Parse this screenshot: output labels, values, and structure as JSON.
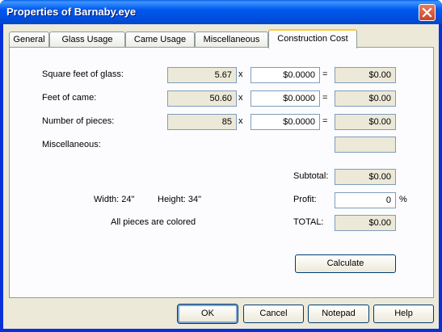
{
  "window": {
    "title": "Properties of Barnaby.eye"
  },
  "tabs": [
    {
      "label": "General"
    },
    {
      "label": "Glass Usage"
    },
    {
      "label": "Came Usage"
    },
    {
      "label": "Miscellaneous"
    },
    {
      "label": "Construction Cost"
    }
  ],
  "active_tab": "Construction Cost",
  "cost": {
    "rows": [
      {
        "label": "Square feet of glass:",
        "quantity": "5.67",
        "op": "x",
        "rate": "$0.0000",
        "eq": "=",
        "total": "$0.00"
      },
      {
        "label": "Feet of came:",
        "quantity": "50.60",
        "op": "x",
        "rate": "$0.0000",
        "eq": "=",
        "total": "$0.00"
      },
      {
        "label": "Number of pieces:",
        "quantity": "85",
        "op": "x",
        "rate": "$0.0000",
        "eq": "=",
        "total": "$0.00"
      }
    ],
    "misc_label": "Miscellaneous:",
    "misc_value": "",
    "subtotal_label": "Subtotal:",
    "subtotal_value": "$0.00",
    "profit_label": "Profit:",
    "profit_value": "0",
    "profit_unit": "%",
    "total_label": "TOTAL:",
    "total_value": "$0.00",
    "width_text": "Width: 24\"",
    "height_text": "Height: 34\"",
    "colored_text": "All pieces are colored",
    "calculate_label": "Calculate"
  },
  "footer": {
    "ok_label": "OK",
    "cancel_label": "Cancel",
    "notepad_label": "Notepad",
    "help_label": "Help"
  }
}
